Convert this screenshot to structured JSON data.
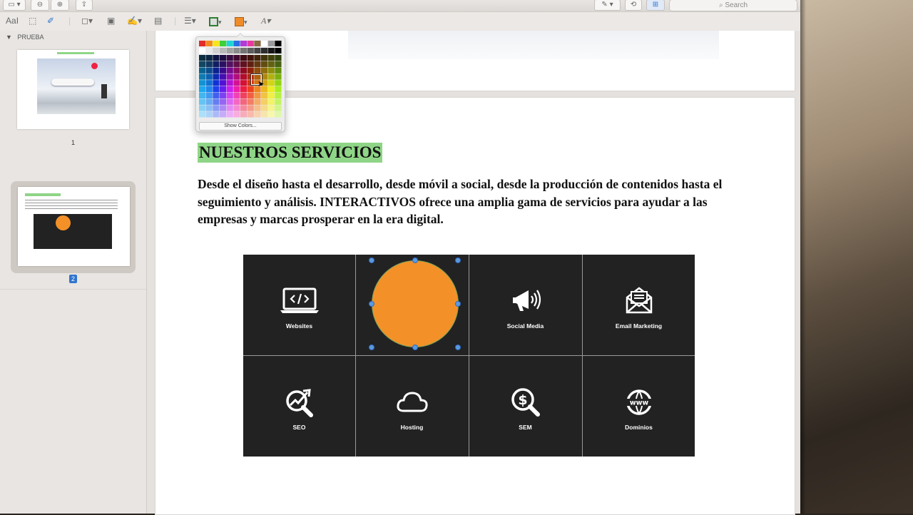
{
  "toolbar": {
    "search_placeholder": "Search",
    "text_style_label": "Aa",
    "fill_color": "#f08c28",
    "border_color": "#2e7d32"
  },
  "sidebar": {
    "section_title": "PRUEBA",
    "pages": [
      {
        "number": "1"
      },
      {
        "number": "2",
        "selected": true
      }
    ],
    "thumb2_title": "NUESTROS SERVICIOS"
  },
  "document": {
    "heading": "NUESTROS SERVICIOS",
    "heading_highlight": "#8fd587",
    "paragraph": "Desde el diseño hasta el desarrollo, desde móvil a social, desde la producción de contenidos hasta el seguimiento y análisis.  INTERACTIVOS ofrece una amplia gama de servicios para ayudar a las empresas y marcas prosperar en la era digital."
  },
  "services": [
    {
      "label": "Websites",
      "icon": "laptop-code-icon"
    },
    {
      "label": "",
      "icon": "orange-circle-shape"
    },
    {
      "label": "Social Media",
      "icon": "megaphone-icon"
    },
    {
      "label": "Email Marketing",
      "icon": "envelope-icon"
    },
    {
      "label": "SEO",
      "icon": "seo-magnifier-chart-icon"
    },
    {
      "label": "Hosting",
      "icon": "cloud-icon"
    },
    {
      "label": "SEM",
      "icon": "dollar-search-icon"
    },
    {
      "label": "Dominios",
      "icon": "www-globe-icon"
    }
  ],
  "color_popover": {
    "show_colors_label": "Show Colors..."
  },
  "colors": {
    "circle_fill": "#f39128",
    "grid_bg": "#222222",
    "selection_handle": "#5b9ae0"
  }
}
